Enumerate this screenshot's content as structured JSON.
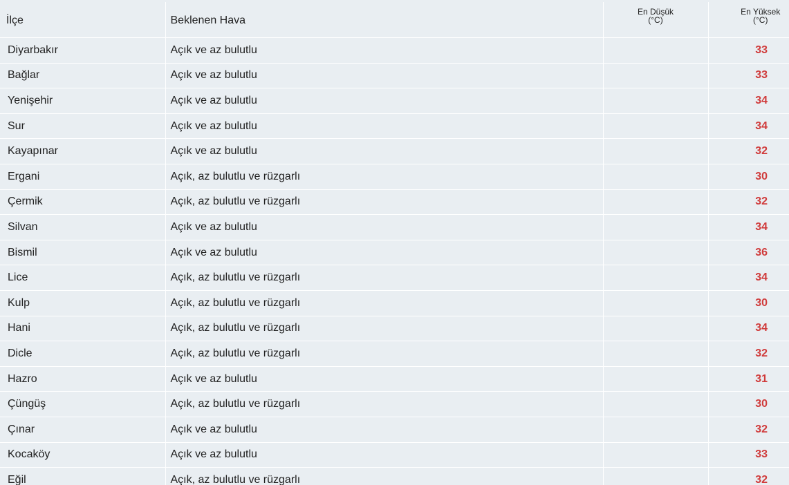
{
  "columns": {
    "district": "İlçe",
    "weather": "Beklenen Hava",
    "min_line1": "En Düşük",
    "min_line2": "(°C)",
    "max_line1": "En Yüksek",
    "max_line2": "(°C)"
  },
  "rows": [
    {
      "district": "Diyarbakır",
      "weather": "Açık ve az bulutlu",
      "min": "",
      "max": "33"
    },
    {
      "district": "Bağlar",
      "weather": "Açık ve az bulutlu",
      "min": "",
      "max": "33"
    },
    {
      "district": "Yenişehir",
      "weather": "Açık ve az bulutlu",
      "min": "",
      "max": "34"
    },
    {
      "district": "Sur",
      "weather": "Açık ve az bulutlu",
      "min": "",
      "max": "34"
    },
    {
      "district": "Kayapınar",
      "weather": "Açık ve az bulutlu",
      "min": "",
      "max": "32"
    },
    {
      "district": "Ergani",
      "weather": "Açık, az bulutlu ve rüzgarlı",
      "min": "",
      "max": "30"
    },
    {
      "district": "Çermik",
      "weather": "Açık, az bulutlu ve rüzgarlı",
      "min": "",
      "max": "32"
    },
    {
      "district": "Silvan",
      "weather": "Açık ve az bulutlu",
      "min": "",
      "max": "34"
    },
    {
      "district": "Bismil",
      "weather": "Açık ve az bulutlu",
      "min": "",
      "max": "36"
    },
    {
      "district": "Lice",
      "weather": "Açık, az bulutlu ve rüzgarlı",
      "min": "",
      "max": "34"
    },
    {
      "district": "Kulp",
      "weather": "Açık, az bulutlu ve rüzgarlı",
      "min": "",
      "max": "30"
    },
    {
      "district": "Hani",
      "weather": "Açık, az bulutlu ve rüzgarlı",
      "min": "",
      "max": "34"
    },
    {
      "district": "Dicle",
      "weather": "Açık, az bulutlu ve rüzgarlı",
      "min": "",
      "max": "32"
    },
    {
      "district": "Hazro",
      "weather": "Açık ve az bulutlu",
      "min": "",
      "max": "31"
    },
    {
      "district": "Çüngüş",
      "weather": "Açık, az bulutlu ve rüzgarlı",
      "min": "",
      "max": "30"
    },
    {
      "district": "Çınar",
      "weather": "Açık ve az bulutlu",
      "min": "",
      "max": "32"
    },
    {
      "district": "Kocaköy",
      "weather": "Açık ve az bulutlu",
      "min": "",
      "max": "33"
    },
    {
      "district": "Eğil",
      "weather": "Açık, az bulutlu ve rüzgarlı",
      "min": "",
      "max": "32"
    }
  ],
  "colors": {
    "background": "#e9eef2",
    "grid": "#ffffff",
    "text": "#222222",
    "max_temp": "#d03b3b"
  }
}
